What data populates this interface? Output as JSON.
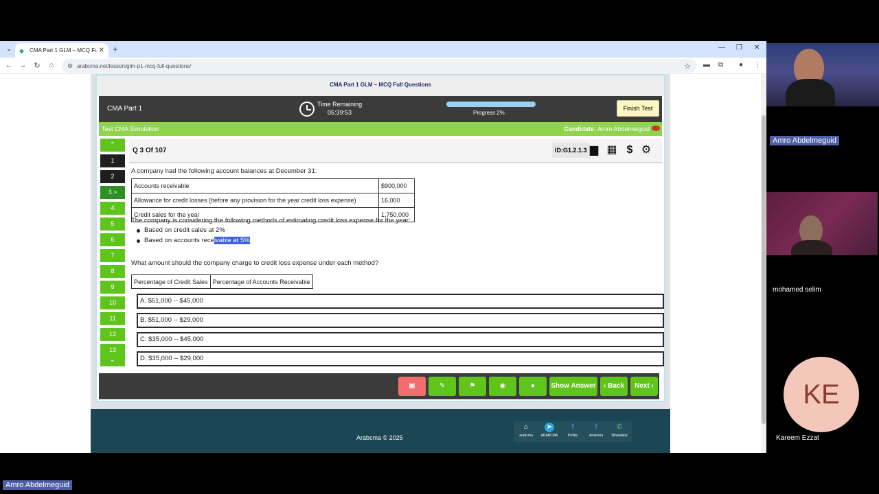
{
  "browser": {
    "tab_title": "CMA Part 1 GLM – MCQ Full Qu",
    "url": "arabcma.net/lesson/glm-p1-mcq-full-questions/"
  },
  "exam": {
    "title": "CMA Part 1 GLM – MCQ Full Questions",
    "part": "CMA Part 1",
    "time_label": "Time Remaining",
    "time_value": "05:39:53",
    "progress_label": "Progress 2%",
    "progress_fraction": 0.02,
    "finish_label": "Finish Test",
    "mode_label": "Test CMA Simulation",
    "candidate_label": "Candidate:",
    "candidate_name": "Amro Abdelmeguid",
    "nav_items": [
      "1",
      "2",
      "3 >",
      "4",
      "5",
      "6",
      "7",
      "8",
      "9",
      "10",
      "11",
      "12",
      "13"
    ],
    "question_counter": "Q 3 Of 107",
    "question_id": "ID:G1.2.1.3",
    "stem": "A company had the following account balances at December 31:",
    "balances": [
      {
        "label": "Accounts receivable",
        "value": "$900,000"
      },
      {
        "label": "Allowance for credit losses (before any provision for the year credit loss expense)",
        "value": "16,000"
      },
      {
        "label": "Credit sales for the year",
        "value": "1,750,000"
      }
    ],
    "methods_intro": "The company is considering the following methods of estimating credit loss expense for the year:",
    "method_1": "Based on credit sales at 2%",
    "method_2_plain": "Based on accounts rece",
    "method_2_highlight": "ivable at 5%",
    "question": "What amount should the company charge to credit loss expense under each method?",
    "col_1": "Percentage of Credit Sales",
    "col_2": "Percentage of Accounts Receivable",
    "answers": [
      "A. $51,000 -- $45,000",
      "B. $51,000 -- $29,000",
      "C. $35,000 -- $45,000",
      "D. $35,000 -- $29,000"
    ],
    "show_answer": "Show Answer",
    "back": "Back",
    "next": "Next"
  },
  "footer": {
    "copyright": "Arabcma © 2025",
    "social": [
      "arabcma",
      "ARABCMA",
      "Profile",
      "Arabcma",
      "WhatsApp"
    ]
  },
  "participants": {
    "p1": "Amro Abdelmeguid",
    "p2": "mohamed selim",
    "p3_initials": "KE",
    "p3": "Kareem Ezzat",
    "self": "Amro Abdelmeguid"
  },
  "colors": {
    "green": "#5fc51c",
    "dark": "#3b3b3b",
    "footer": "#1c4654",
    "highlight": "#3a63d6"
  }
}
